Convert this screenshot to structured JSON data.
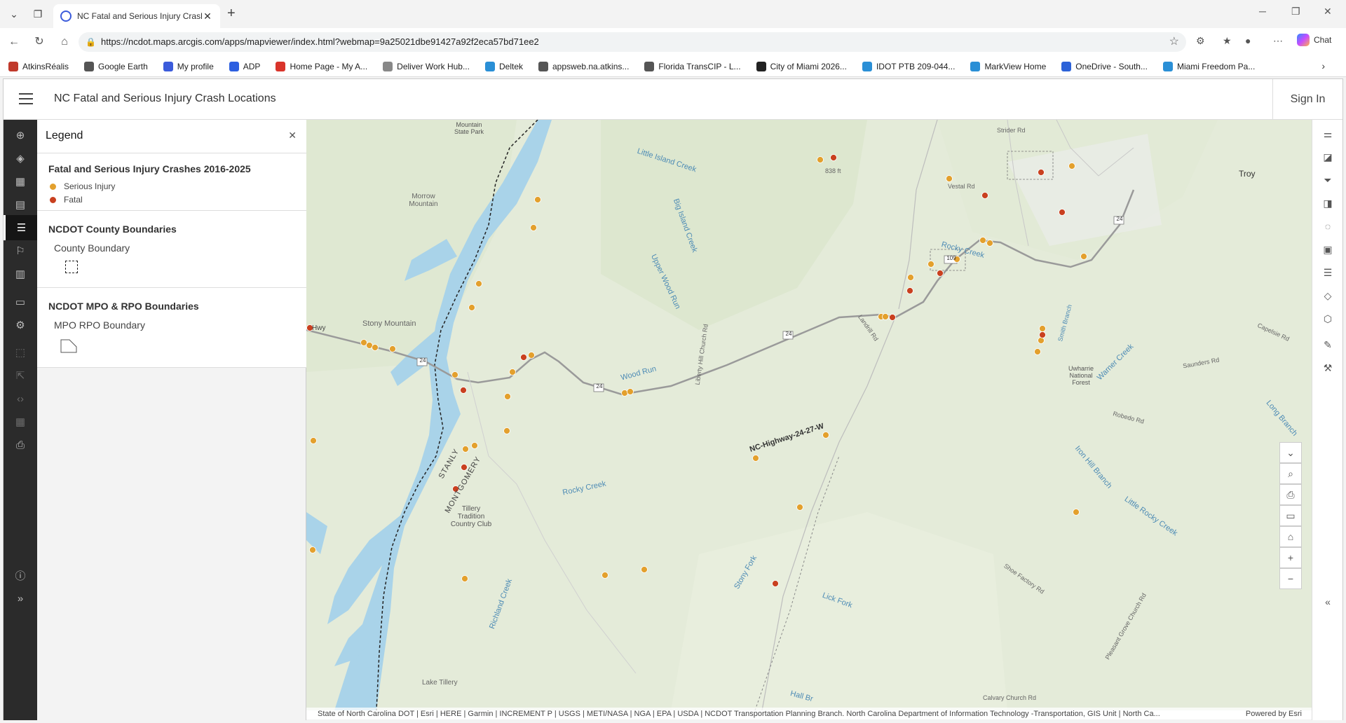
{
  "browser": {
    "tab_title": "NC Fatal and Serious Injury Crash L",
    "url": "https://ncdot.maps.arcgis.com/apps/mapviewer/index.html?webmap=9a25021dbe91427a92f2eca57bd71ee2",
    "chat_label": "Chat",
    "bookmarks": [
      "AtkinsRéalis",
      "Google Earth",
      "My profile",
      "ADP",
      "Home Page - My A...",
      "Deliver Work Hub...",
      "Deltek",
      "appsweb.na.atkins...",
      "Florida TransCIP - L...",
      "City of Miami 2026...",
      "IDOT PTB 209-044...",
      "MarkView Home",
      "OneDrive - South...",
      "Miami Freedom Pa..."
    ],
    "bookmark_colors": [
      "#c0392b",
      "#555555",
      "#3b5bdb",
      "#2d5fe0",
      "#d9342b",
      "#888888",
      "#2a8fd6",
      "#555555",
      "#555555",
      "#222222",
      "#2a8fd6",
      "#2a8fd6",
      "#2c62d8",
      "#2a8fd6"
    ]
  },
  "app": {
    "title": "NC Fatal and Serious Injury Crash Locations",
    "sign_in": "Sign In"
  },
  "legend": {
    "title": "Legend",
    "layer1": {
      "title": "Fatal and Serious Injury Crashes 2016-2025",
      "items": [
        {
          "label": "Serious Injury",
          "color": "#e3a02d"
        },
        {
          "label": "Fatal",
          "color": "#c9401f"
        }
      ]
    },
    "layer2": {
      "title": "NCDOT County Boundaries",
      "item": "County Boundary"
    },
    "layer3": {
      "title": "NCDOT MPO & RPO Boundaries",
      "item": "MPO RPO Boundary"
    }
  },
  "map": {
    "labels": {
      "park": "Mountain State Park",
      "morrow": "Morrow Mountain",
      "stony": "Stony Mountain",
      "little_island": "Little Island Creek",
      "big_island": "Big Island Creek",
      "upper_wood": "Upper Wood Run",
      "wood_run": "Wood Run",
      "rocky_creek1": "Rocky Creek",
      "rocky_creek2": "Rocky Creek",
      "nc_highway": "NC-Highway-24-27-W",
      "liberty": "Liberty Hill Church Rd",
      "landrill": "Landrill Rd",
      "vestal": "Vestal Rd",
      "strider": "Strider Rd",
      "troy": "Troy",
      "uwharrie": "Uwharrie National Forest",
      "warner": "Warner Creek",
      "saunders": "Saunders Rd",
      "long_branch": "Long Branch",
      "robedo": "Robedo Rd",
      "iron_hill": "Iron Hill Branch",
      "little_rocky": "Little Rocky Creek",
      "shoe_factory": "Shoe Factory Rd",
      "lick_fork": "Lick Fork",
      "stony_fork": "Stony Fork",
      "tillery": "Tillery Tradition Country Club",
      "richland": "Richland Creek",
      "lake_tillery": "Lake Tillery",
      "stanly": "STANLY",
      "montgomery": "MONTGOMERY",
      "hwy": "Hwy",
      "route24a": "24",
      "route24b": "24",
      "route24c": "24",
      "route24d": "24",
      "route109": "109",
      "elev838": "838 ft",
      "hall_br": "Hall Br",
      "calvary": "Calvary Church Rd",
      "pleasant": "Pleasant Grove Church Rd",
      "smith": "Smith Branch",
      "capelsie": "Capelsie Rd"
    },
    "attribution": "State of North Carolina DOT | Esri | HERE | Garmin | INCREMENT P | USGS | METI/NASA | NGA | EPA | USDA | NCDOT Transportation Planning Branch. North Carolina Department of Information Technology -Transportation, GIS Unit | North Ca...",
    "powered_by": "Powered by Esri"
  }
}
